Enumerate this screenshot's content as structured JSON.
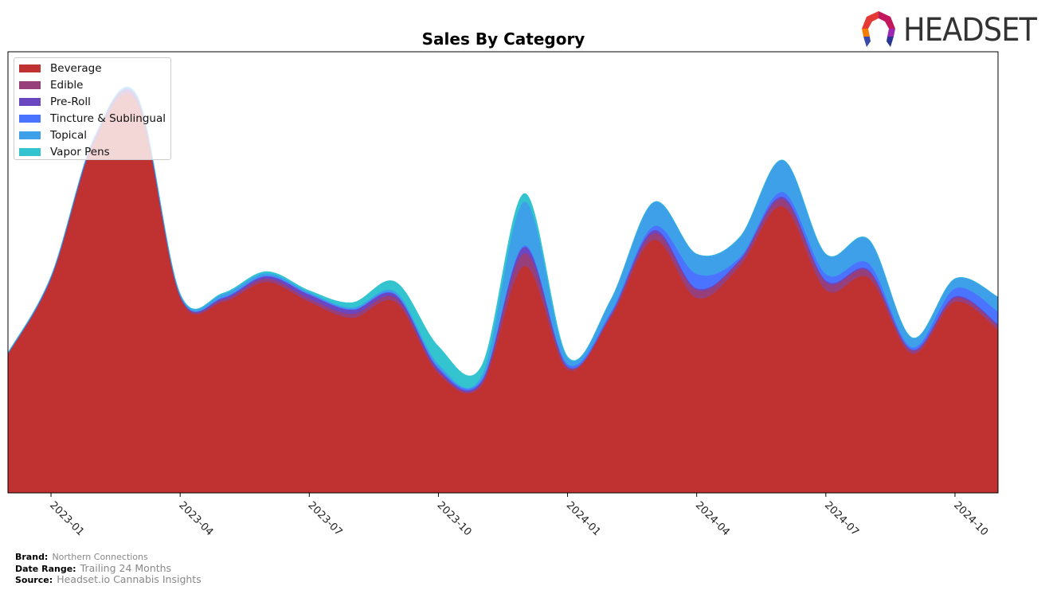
{
  "header": {
    "logo_text": "HEADSET"
  },
  "chart_data": {
    "type": "area",
    "stacked": true,
    "title": "Sales By Category",
    "xlabel": "",
    "ylabel": "",
    "y_axis_visible": false,
    "grid": false,
    "legend_position": "top-left",
    "x": [
      "2022-12",
      "2023-01",
      "2023-02",
      "2023-03",
      "2023-04",
      "2023-05",
      "2023-06",
      "2023-07",
      "2023-08",
      "2023-09",
      "2023-10",
      "2023-11",
      "2023-12",
      "2024-01",
      "2024-02",
      "2024-03",
      "2024-04",
      "2024-05",
      "2024-06",
      "2024-07",
      "2024-08",
      "2024-09",
      "2024-10",
      "2024-11"
    ],
    "x_ticks": [
      "2023-01",
      "2023-04",
      "2023-07",
      "2023-10",
      "2024-01",
      "2024-04",
      "2024-07",
      "2024-10"
    ],
    "ylim": [
      0,
      554
    ],
    "series": [
      {
        "name": "Beverage",
        "color": "#c03232",
        "values": [
          174,
          268,
          440,
          490,
          245,
          240,
          265,
          240,
          220,
          240,
          150,
          135,
          285,
          155,
          220,
          318,
          245,
          285,
          360,
          255,
          270,
          175,
          240,
          205
        ]
      },
      {
        "name": "Edible",
        "color": "#973f7b",
        "values": [
          1,
          2,
          3,
          4,
          2,
          3,
          4,
          4,
          5,
          5,
          3,
          3,
          16,
          3,
          3,
          8,
          10,
          6,
          9,
          10,
          8,
          4,
          5,
          5
        ]
      },
      {
        "name": "Pre-Roll",
        "color": "#6b46c1",
        "values": [
          0,
          1,
          2,
          3,
          1,
          2,
          3,
          5,
          5,
          4,
          3,
          2,
          8,
          1,
          1,
          4,
          2,
          2,
          3,
          2,
          2,
          1,
          2,
          2
        ]
      },
      {
        "name": "Tincture & Sublingual",
        "color": "#4a74ff",
        "values": [
          0,
          0,
          0,
          0,
          0,
          1,
          1,
          1,
          1,
          1,
          2,
          2,
          2,
          3,
          3,
          5,
          18,
          3,
          6,
          8,
          8,
          3,
          10,
          16
        ]
      },
      {
        "name": "Topical",
        "color": "#3ea0e8",
        "values": [
          1,
          1,
          1,
          2,
          2,
          4,
          3,
          2,
          2,
          3,
          4,
          5,
          55,
          8,
          15,
          30,
          25,
          25,
          40,
          25,
          30,
          12,
          12,
          18
        ]
      },
      {
        "name": "Vapor Pens",
        "color": "#33c4d0",
        "values": [
          0,
          0,
          0,
          0,
          0,
          1,
          2,
          2,
          6,
          12,
          22,
          12,
          10,
          1,
          0,
          0,
          0,
          0,
          0,
          0,
          0,
          0,
          0,
          0
        ]
      }
    ]
  },
  "footer": {
    "brand_label": "Brand:",
    "brand_value": "Northern Connections",
    "date_range_label": "Date Range:",
    "date_range_value": "Trailing 24 Months",
    "source_label": "Source:",
    "source_value": "Headset.io Cannabis Insights"
  }
}
